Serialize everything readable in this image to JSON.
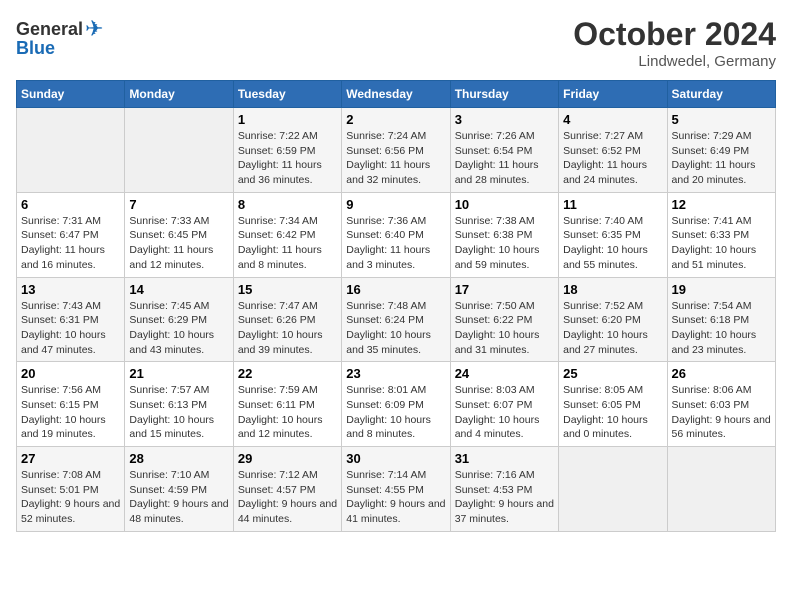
{
  "logo": {
    "general": "General",
    "blue": "Blue"
  },
  "title": "October 2024",
  "subtitle": "Lindwedel, Germany",
  "days_header": [
    "Sunday",
    "Monday",
    "Tuesday",
    "Wednesday",
    "Thursday",
    "Friday",
    "Saturday"
  ],
  "weeks": [
    [
      {
        "num": "",
        "info": ""
      },
      {
        "num": "",
        "info": ""
      },
      {
        "num": "1",
        "info": "Sunrise: 7:22 AM\nSunset: 6:59 PM\nDaylight: 11 hours and 36 minutes."
      },
      {
        "num": "2",
        "info": "Sunrise: 7:24 AM\nSunset: 6:56 PM\nDaylight: 11 hours and 32 minutes."
      },
      {
        "num": "3",
        "info": "Sunrise: 7:26 AM\nSunset: 6:54 PM\nDaylight: 11 hours and 28 minutes."
      },
      {
        "num": "4",
        "info": "Sunrise: 7:27 AM\nSunset: 6:52 PM\nDaylight: 11 hours and 24 minutes."
      },
      {
        "num": "5",
        "info": "Sunrise: 7:29 AM\nSunset: 6:49 PM\nDaylight: 11 hours and 20 minutes."
      }
    ],
    [
      {
        "num": "6",
        "info": "Sunrise: 7:31 AM\nSunset: 6:47 PM\nDaylight: 11 hours and 16 minutes."
      },
      {
        "num": "7",
        "info": "Sunrise: 7:33 AM\nSunset: 6:45 PM\nDaylight: 11 hours and 12 minutes."
      },
      {
        "num": "8",
        "info": "Sunrise: 7:34 AM\nSunset: 6:42 PM\nDaylight: 11 hours and 8 minutes."
      },
      {
        "num": "9",
        "info": "Sunrise: 7:36 AM\nSunset: 6:40 PM\nDaylight: 11 hours and 3 minutes."
      },
      {
        "num": "10",
        "info": "Sunrise: 7:38 AM\nSunset: 6:38 PM\nDaylight: 10 hours and 59 minutes."
      },
      {
        "num": "11",
        "info": "Sunrise: 7:40 AM\nSunset: 6:35 PM\nDaylight: 10 hours and 55 minutes."
      },
      {
        "num": "12",
        "info": "Sunrise: 7:41 AM\nSunset: 6:33 PM\nDaylight: 10 hours and 51 minutes."
      }
    ],
    [
      {
        "num": "13",
        "info": "Sunrise: 7:43 AM\nSunset: 6:31 PM\nDaylight: 10 hours and 47 minutes."
      },
      {
        "num": "14",
        "info": "Sunrise: 7:45 AM\nSunset: 6:29 PM\nDaylight: 10 hours and 43 minutes."
      },
      {
        "num": "15",
        "info": "Sunrise: 7:47 AM\nSunset: 6:26 PM\nDaylight: 10 hours and 39 minutes."
      },
      {
        "num": "16",
        "info": "Sunrise: 7:48 AM\nSunset: 6:24 PM\nDaylight: 10 hours and 35 minutes."
      },
      {
        "num": "17",
        "info": "Sunrise: 7:50 AM\nSunset: 6:22 PM\nDaylight: 10 hours and 31 minutes."
      },
      {
        "num": "18",
        "info": "Sunrise: 7:52 AM\nSunset: 6:20 PM\nDaylight: 10 hours and 27 minutes."
      },
      {
        "num": "19",
        "info": "Sunrise: 7:54 AM\nSunset: 6:18 PM\nDaylight: 10 hours and 23 minutes."
      }
    ],
    [
      {
        "num": "20",
        "info": "Sunrise: 7:56 AM\nSunset: 6:15 PM\nDaylight: 10 hours and 19 minutes."
      },
      {
        "num": "21",
        "info": "Sunrise: 7:57 AM\nSunset: 6:13 PM\nDaylight: 10 hours and 15 minutes."
      },
      {
        "num": "22",
        "info": "Sunrise: 7:59 AM\nSunset: 6:11 PM\nDaylight: 10 hours and 12 minutes."
      },
      {
        "num": "23",
        "info": "Sunrise: 8:01 AM\nSunset: 6:09 PM\nDaylight: 10 hours and 8 minutes."
      },
      {
        "num": "24",
        "info": "Sunrise: 8:03 AM\nSunset: 6:07 PM\nDaylight: 10 hours and 4 minutes."
      },
      {
        "num": "25",
        "info": "Sunrise: 8:05 AM\nSunset: 6:05 PM\nDaylight: 10 hours and 0 minutes."
      },
      {
        "num": "26",
        "info": "Sunrise: 8:06 AM\nSunset: 6:03 PM\nDaylight: 9 hours and 56 minutes."
      }
    ],
    [
      {
        "num": "27",
        "info": "Sunrise: 7:08 AM\nSunset: 5:01 PM\nDaylight: 9 hours and 52 minutes."
      },
      {
        "num": "28",
        "info": "Sunrise: 7:10 AM\nSunset: 4:59 PM\nDaylight: 9 hours and 48 minutes."
      },
      {
        "num": "29",
        "info": "Sunrise: 7:12 AM\nSunset: 4:57 PM\nDaylight: 9 hours and 44 minutes."
      },
      {
        "num": "30",
        "info": "Sunrise: 7:14 AM\nSunset: 4:55 PM\nDaylight: 9 hours and 41 minutes."
      },
      {
        "num": "31",
        "info": "Sunrise: 7:16 AM\nSunset: 4:53 PM\nDaylight: 9 hours and 37 minutes."
      },
      {
        "num": "",
        "info": ""
      },
      {
        "num": "",
        "info": ""
      }
    ]
  ]
}
